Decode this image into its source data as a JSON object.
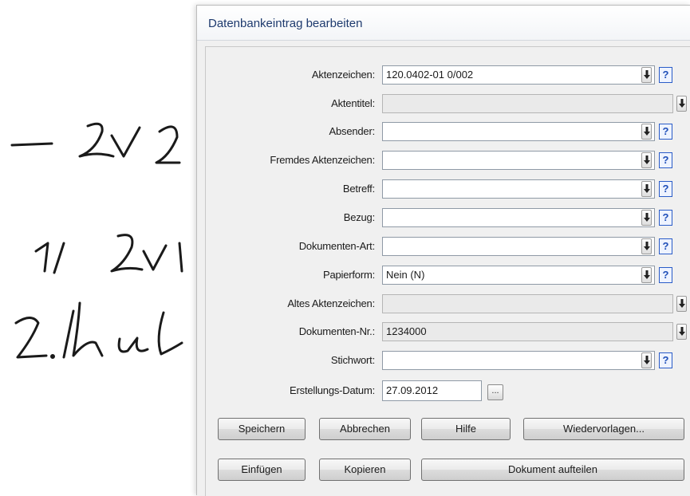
{
  "dialog": {
    "title": "Datenbankeintrag bearbeiten"
  },
  "fields": [
    {
      "label": "Aktenzeichen:",
      "value": "120.0402-01 0/002",
      "readonly": false,
      "help": true
    },
    {
      "label": "Aktentitel:",
      "value": "",
      "readonly": true,
      "help": false
    },
    {
      "label": "Absender:",
      "value": "",
      "readonly": false,
      "help": true
    },
    {
      "label": "Fremdes Aktenzeichen:",
      "value": "",
      "readonly": false,
      "help": true
    },
    {
      "label": "Betreff:",
      "value": "",
      "readonly": false,
      "help": true
    },
    {
      "label": "Bezug:",
      "value": "",
      "readonly": false,
      "help": true
    },
    {
      "label": "Dokumenten-Art:",
      "value": "",
      "readonly": false,
      "help": true
    },
    {
      "label": "Papierform:",
      "value": "Nein (N)",
      "readonly": false,
      "help": true
    },
    {
      "label": "Altes Aktenzeichen:",
      "value": "",
      "readonly": true,
      "help": false
    },
    {
      "label": "Dokumenten-Nr.:",
      "value": "1234000",
      "readonly": true,
      "help": false
    },
    {
      "label": "Stichwort:",
      "value": "",
      "readonly": false,
      "help": true
    }
  ],
  "help_glyph": "?",
  "date": {
    "label": "Erstellungs-Datum:",
    "value": "27.09.2012",
    "button": "..."
  },
  "buttons": {
    "save": "Speichern",
    "cancel": "Abbrechen",
    "help": "Hilfe",
    "resubmission": "Wiedervorlagen...",
    "insert": "Einfügen",
    "copy": "Kopieren",
    "split": "Dokument aufteilen"
  },
  "icons": {
    "download": "download-arrow-icon",
    "help": "help-question-icon"
  }
}
